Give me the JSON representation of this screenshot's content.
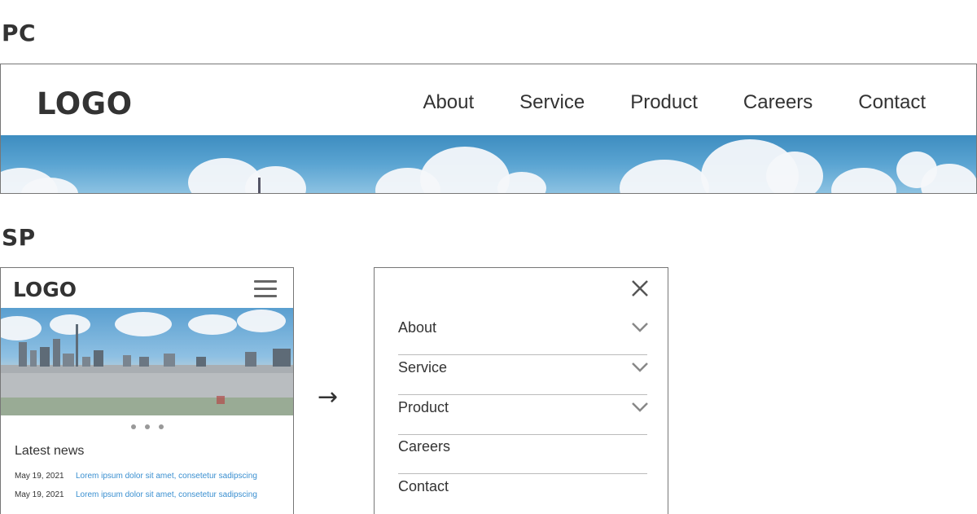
{
  "labels": {
    "pc": "PC",
    "sp": "SP"
  },
  "pc_header": {
    "logo": "LOGO",
    "nav": [
      "About",
      "Service",
      "Product",
      "Careers",
      "Contact"
    ]
  },
  "sp_page": {
    "logo": "LOGO",
    "news_title": "Latest news",
    "news": [
      {
        "date": "May 19, 2021",
        "text": "Lorem ipsum dolor sit amet, consetetur sadipscing"
      },
      {
        "date": "May 19, 2021",
        "text": "Lorem ipsum dolor sit amet, consetetur sadipscing"
      }
    ],
    "carousel_dots": 3
  },
  "transition_arrow": "→",
  "sp_menu": {
    "items": [
      {
        "label": "About",
        "has_submenu": true
      },
      {
        "label": "Service",
        "has_submenu": true
      },
      {
        "label": "Product",
        "has_submenu": true
      },
      {
        "label": "Careers",
        "has_submenu": false
      },
      {
        "label": "Contact",
        "has_submenu": false
      }
    ]
  },
  "colors": {
    "text": "#333333",
    "link": "#3a8fd0",
    "border": "#777777"
  }
}
